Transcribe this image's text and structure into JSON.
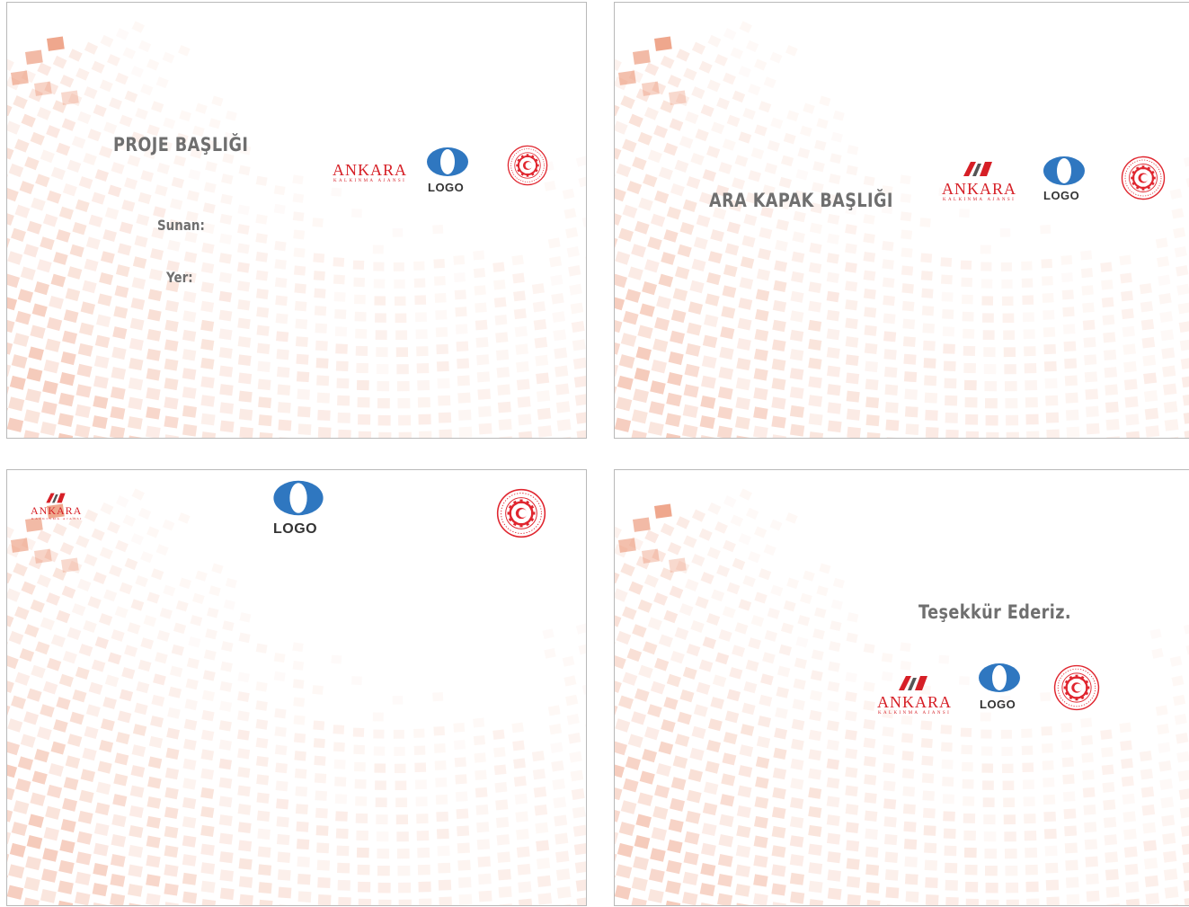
{
  "slides": {
    "cover": {
      "title": "PROJE BAŞLIĞI",
      "presenter_label": "Sunan:",
      "place_label": "Yer:"
    },
    "section": {
      "title": "ARA KAPAK BAŞLIĞI"
    },
    "content": {},
    "closing": {
      "title": "Teşekkür Ederiz."
    }
  },
  "logos": {
    "ankara": {
      "name": "ANKARA",
      "subtitle": "KALKINMA AJANSI",
      "icon": "ankara-agency-emblem"
    },
    "placeholder": {
      "text": "LOGO",
      "icon": "blue-ring-logo"
    },
    "ministry_seal": {
      "icon": "red-gear-seal"
    }
  },
  "colors": {
    "title_text": "#6f6f6f",
    "tile_orange": "#e8825c",
    "ankara_red": "#d61f26",
    "logo_blue": "#2f77c0",
    "logo_text": "#333333",
    "seal_red": "#e0262f",
    "border": "#b9b9b9"
  }
}
